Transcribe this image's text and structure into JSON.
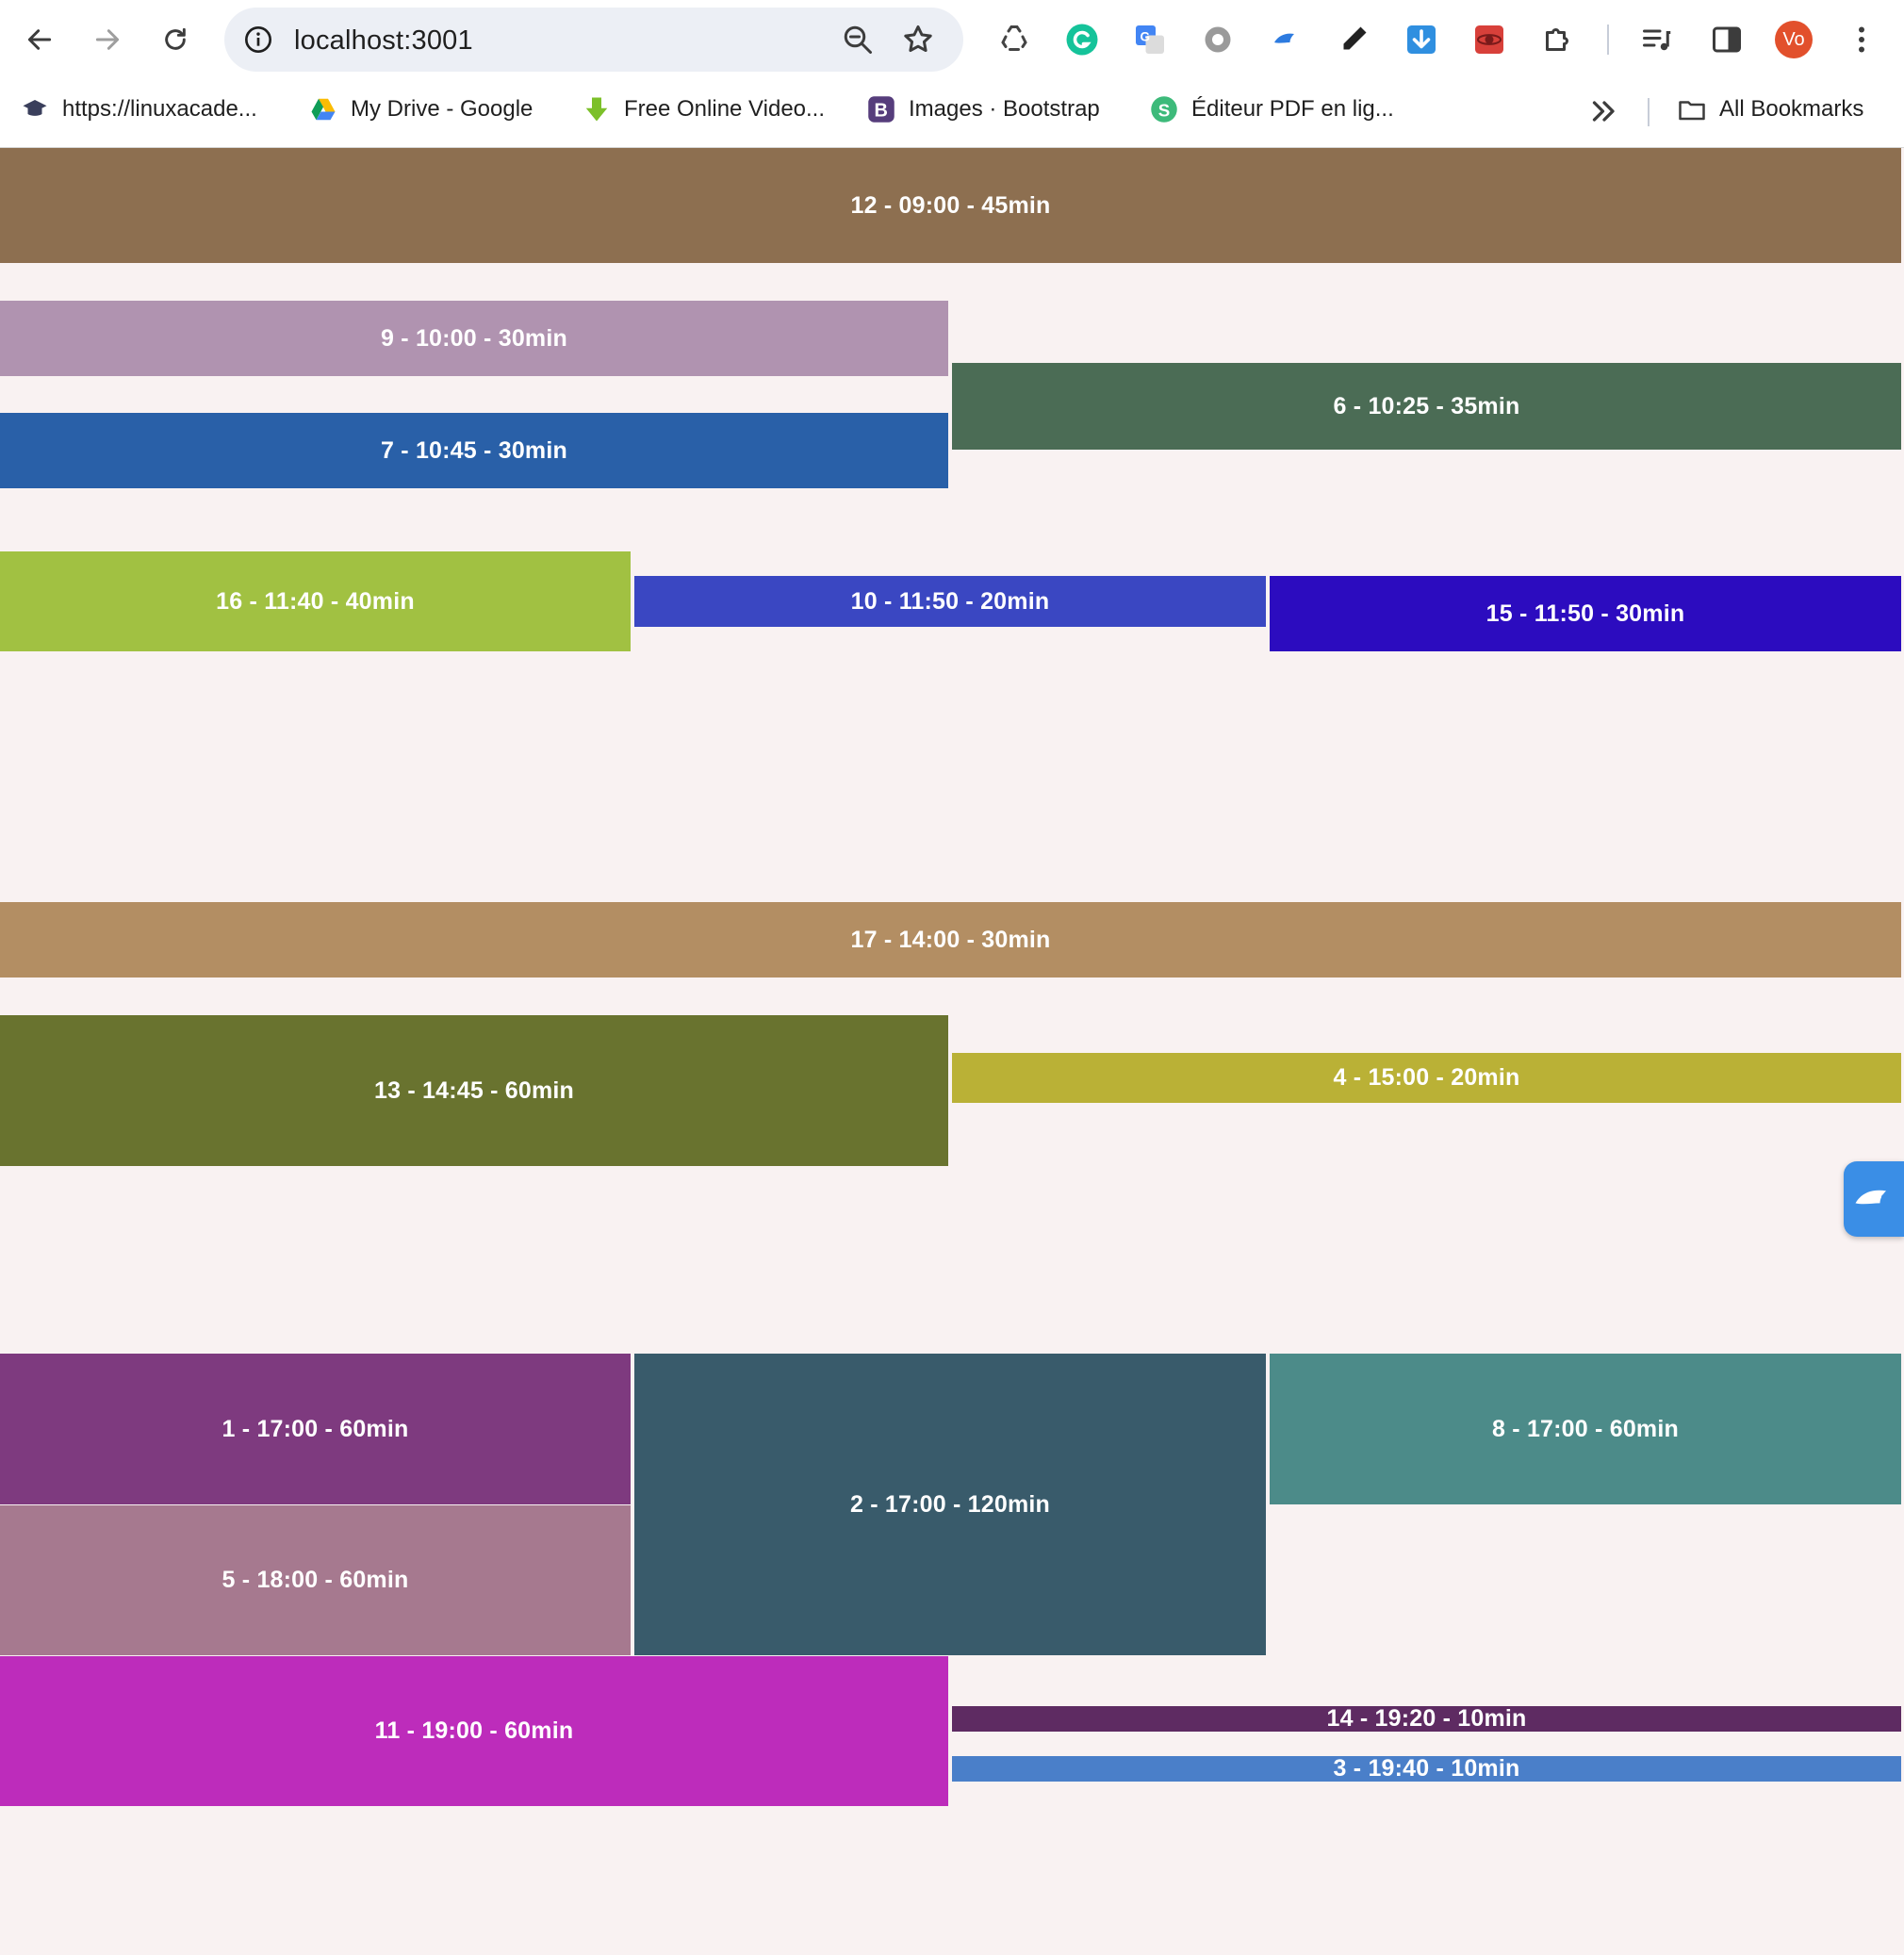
{
  "browser": {
    "url": "localhost:3001",
    "avatar_initials": "Vo",
    "bookmarks": [
      {
        "label": "https://linuxacade..."
      },
      {
        "label": "My Drive - Google"
      },
      {
        "label": "Free Online Video..."
      },
      {
        "label": "Images · Bootstrap"
      },
      {
        "label": "Éditeur PDF en lig..."
      }
    ],
    "all_bookmarks_label": "All Bookmarks"
  },
  "events": [
    {
      "id": 12,
      "label": "12 - 09:00 - 45min",
      "color": "#8d6f50"
    },
    {
      "id": 9,
      "label": "9 - 10:00 - 30min",
      "color": "#b093b0"
    },
    {
      "id": 6,
      "label": "6 - 10:25 - 35min",
      "color": "#4b6c55"
    },
    {
      "id": 7,
      "label": "7 - 10:45 - 30min",
      "color": "#2960a8"
    },
    {
      "id": 16,
      "label": "16 - 11:40 - 40min",
      "color": "#a1c142"
    },
    {
      "id": 10,
      "label": "10 - 11:50 - 20min",
      "color": "#3a47c2"
    },
    {
      "id": 15,
      "label": "15 - 11:50 - 30min",
      "color": "#2c0cbf"
    },
    {
      "id": 17,
      "label": "17 - 14:00 - 30min",
      "color": "#b38e63"
    },
    {
      "id": 13,
      "label": "13 - 14:45 - 60min",
      "color": "#69732f"
    },
    {
      "id": 4,
      "label": "4 - 15:00 - 20min",
      "color": "#bab136"
    },
    {
      "id": 1,
      "label": "1 - 17:00 - 60min",
      "color": "#7e3a7f"
    },
    {
      "id": 2,
      "label": "2 - 17:00 - 120min",
      "color": "#395b6b"
    },
    {
      "id": 8,
      "label": "8 - 17:00 - 60min",
      "color": "#4c8b89"
    },
    {
      "id": 5,
      "label": "5 - 18:00 - 60min",
      "color": "#a6798f"
    },
    {
      "id": 11,
      "label": "11 - 19:00 - 60min",
      "color": "#bd2cbb"
    },
    {
      "id": 14,
      "label": "14 - 19:20 - 10min",
      "color": "#5e2b62"
    },
    {
      "id": 3,
      "label": "3 - 19:40 - 10min",
      "color": "#4a7fc9"
    }
  ]
}
